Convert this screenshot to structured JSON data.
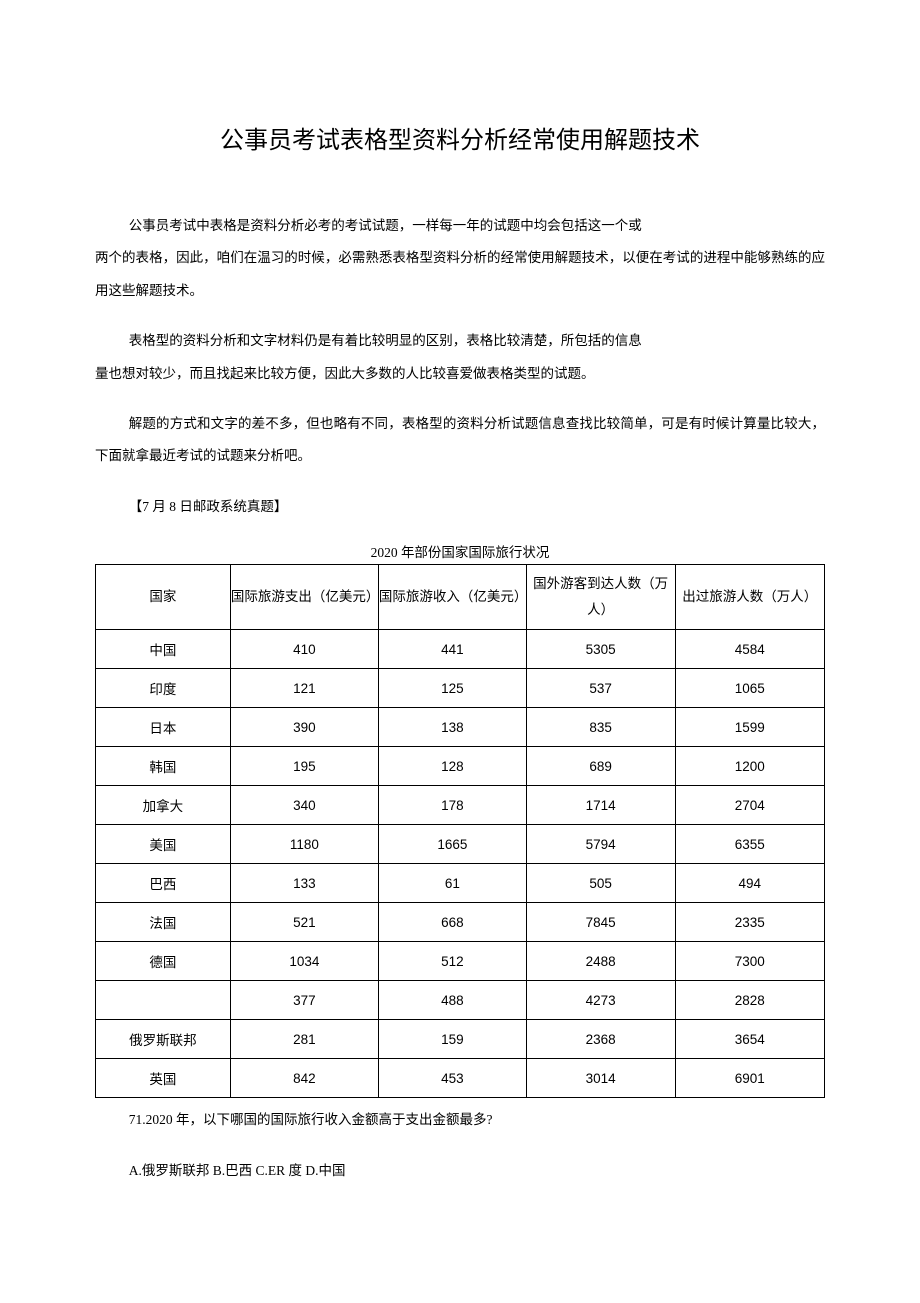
{
  "title": "公事员考试表格型资料分析经常使用解题技术",
  "paragraphs": {
    "p1a": "公事员考试中表格是资料分析必考的考试试题，一样每一年的试题中均会包括这一个或",
    "p1b": "两个的表格，因此，咱们在温习的时候，必需熟悉表格型资料分析的经常使用解题技术，以便在考试的进程中能够熟练的应用这些解题技术。",
    "p2a": "表格型的资料分析和文字材料仍是有着比较明显的区别，表格比较清楚，所包括的信息",
    "p2b": "量也想对较少，而且找起来比较方便，因此大多数的人比较喜爱做表格类型的试题。",
    "p3": "解题的方式和文字的差不多，但也略有不同，表格型的资料分析试题信息查找比较简单，可是有时候计算量比较大，下面就拿最近考试的试题来分析吧。",
    "p4": "【7 月 8 日邮政系统真题】"
  },
  "table_title": "2020 年部份国家国际旅行状况",
  "headers": {
    "h0": "国家",
    "h1": "国际旅游支出（亿美元）",
    "h2": "国际旅游收入（亿美元）",
    "h3": "国外游客到达人数（万人）",
    "h4": "出过旅游人数（万人）"
  },
  "rows": [
    {
      "c": "中国",
      "v1": "410",
      "v2": "441",
      "v3": "5305",
      "v4": "4584"
    },
    {
      "c": "印度",
      "v1": "121",
      "v2": "125",
      "v3": "537",
      "v4": "1065"
    },
    {
      "c": "日本",
      "v1": "390",
      "v2": "138",
      "v3": "835",
      "v4": "1599"
    },
    {
      "c": "韩国",
      "v1": "195",
      "v2": "128",
      "v3": "689",
      "v4": "1200"
    },
    {
      "c": "加拿大",
      "v1": "340",
      "v2": "178",
      "v3": "1714",
      "v4": "2704"
    },
    {
      "c": "美国",
      "v1": "1180",
      "v2": "1665",
      "v3": "5794",
      "v4": "6355"
    },
    {
      "c": "巴西",
      "v1": "133",
      "v2": "61",
      "v3": "505",
      "v4": "494"
    },
    {
      "c": "法国",
      "v1": "521",
      "v2": "668",
      "v3": "7845",
      "v4": "2335"
    },
    {
      "c": "德国",
      "v1": "1034",
      "v2": "512",
      "v3": "2488",
      "v4": "7300"
    },
    {
      "c": "",
      "v1": "377",
      "v2": "488",
      "v3": "4273",
      "v4": "2828"
    },
    {
      "c": "俄罗斯联邦",
      "v1": "281",
      "v2": "159",
      "v3": "2368",
      "v4": "3654"
    },
    {
      "c": "英国",
      "v1": "842",
      "v2": "453",
      "v3": "3014",
      "v4": "6901"
    }
  ],
  "question": "71.2020 年，以下哪国的国际旅行收入金额高于支出金额最多?",
  "options": "A.俄罗斯联邦 B.巴西 C.ER 度 D.中国",
  "chart_data": {
    "type": "table",
    "title": "2020 年部份国家国际旅行状况",
    "columns": [
      "国家",
      "国际旅游支出（亿美元）",
      "国际旅游收入（亿美元）",
      "国外游客到达人数（万人）",
      "出过旅游人数（万人）"
    ],
    "data": [
      [
        "中国",
        410,
        441,
        5305,
        4584
      ],
      [
        "印度",
        121,
        125,
        537,
        1065
      ],
      [
        "日本",
        390,
        138,
        835,
        1599
      ],
      [
        "韩国",
        195,
        128,
        689,
        1200
      ],
      [
        "加拿大",
        340,
        178,
        1714,
        2704
      ],
      [
        "美国",
        1180,
        1665,
        5794,
        6355
      ],
      [
        "巴西",
        133,
        61,
        505,
        494
      ],
      [
        "法国",
        521,
        668,
        7845,
        2335
      ],
      [
        "德国",
        1034,
        512,
        2488,
        7300
      ],
      [
        "",
        377,
        488,
        4273,
        2828
      ],
      [
        "俄罗斯联邦",
        281,
        159,
        2368,
        3654
      ],
      [
        "英国",
        842,
        453,
        3014,
        6901
      ]
    ]
  }
}
